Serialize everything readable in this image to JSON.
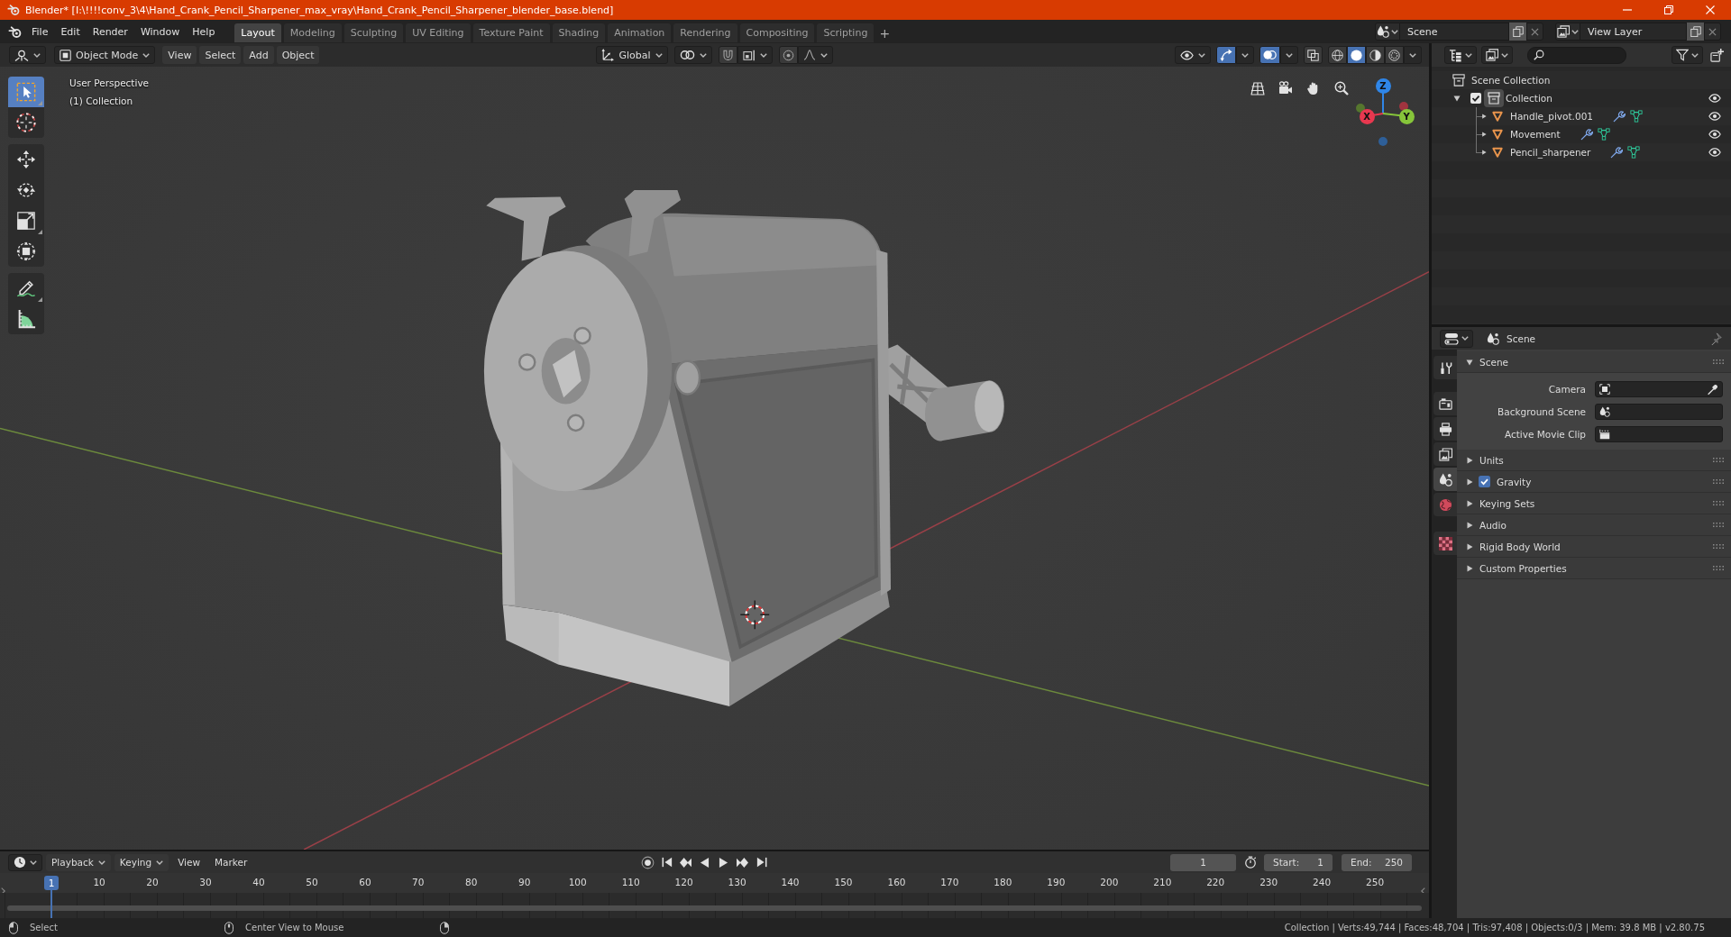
{
  "window": {
    "title": "Blender* [I:\\!!!!conv_3\\4\\Hand_Crank_Pencil_Sharpener_max_vray\\Hand_Crank_Pencil_Sharpener_blender_base.blend]"
  },
  "menu": [
    "File",
    "Edit",
    "Render",
    "Window",
    "Help"
  ],
  "workspaces": [
    {
      "label": "Layout",
      "selected": true
    },
    {
      "label": "Modeling",
      "selected": false
    },
    {
      "label": "Sculpting",
      "selected": false
    },
    {
      "label": "UV Editing",
      "selected": false
    },
    {
      "label": "Texture Paint",
      "selected": false
    },
    {
      "label": "Shading",
      "selected": false
    },
    {
      "label": "Animation",
      "selected": false
    },
    {
      "label": "Rendering",
      "selected": false
    },
    {
      "label": "Compositing",
      "selected": false
    },
    {
      "label": "Scripting",
      "selected": false
    }
  ],
  "add_workspace": "+",
  "scene": {
    "value": "Scene"
  },
  "view_layer": {
    "value": "View Layer"
  },
  "viewport": {
    "mode": "Object Mode",
    "menus": [
      "View",
      "Select",
      "Add",
      "Object"
    ],
    "orientation": "Global",
    "toggles": {
      "snap": false,
      "proportional_editing": false,
      "gizmos": true,
      "overlays": true,
      "xray": false
    },
    "shading": [
      {
        "kind": "wireframe",
        "selected": false
      },
      {
        "kind": "solid",
        "selected": true
      },
      {
        "kind": "material",
        "selected": false
      },
      {
        "kind": "rendered",
        "selected": false
      }
    ],
    "tools": [
      {
        "kind": "select-box",
        "selected": true
      },
      {
        "kind": "cursor",
        "selected": false
      },
      {
        "kind": "move",
        "selected": false
      },
      {
        "kind": "rotate",
        "selected": false
      },
      {
        "kind": "scale",
        "selected": false
      },
      {
        "kind": "transform",
        "selected": false
      },
      {
        "kind": "annotate",
        "selected": false
      },
      {
        "kind": "measure",
        "selected": false
      }
    ],
    "info": [
      "User Perspective",
      "(1) Collection"
    ],
    "gizmo_axes": [
      {
        "label": "Z",
        "color": "#2f86e8"
      },
      {
        "label": "X",
        "color": "#e8384f"
      },
      {
        "label": "Y",
        "color": "#86c53a"
      }
    ]
  },
  "outliner": {
    "root": "Scene Collection",
    "items": [
      {
        "label": "Collection",
        "expanded": true,
        "checked": true,
        "visible": true,
        "children": [
          {
            "label": "Handle_pivot.001",
            "expanded": false,
            "visible": true
          },
          {
            "label": "Movement",
            "expanded": false,
            "visible": true
          },
          {
            "label": "Pencil_sharpener",
            "expanded": false,
            "visible": true
          }
        ]
      }
    ]
  },
  "properties": {
    "context": "Scene",
    "tabs": [
      {
        "kind": "tool",
        "selected": false
      },
      {
        "kind": "render",
        "selected": false
      },
      {
        "kind": "output",
        "selected": false
      },
      {
        "kind": "view-layer",
        "selected": false
      },
      {
        "kind": "scene",
        "selected": true
      },
      {
        "kind": "world",
        "selected": false
      },
      {
        "kind": "texture",
        "selected": false
      }
    ],
    "panels": [
      {
        "label": "Scene",
        "expanded": true,
        "fields": [
          {
            "label": "Camera",
            "kind": "camera"
          },
          {
            "label": "Background Scene",
            "kind": "scene"
          },
          {
            "label": "Active Movie Clip",
            "kind": "movie-clip"
          }
        ]
      },
      {
        "label": "Units",
        "expanded": false
      },
      {
        "label": "Gravity",
        "expanded": false,
        "checkbox": {
          "checked": true
        }
      },
      {
        "label": "Keying Sets",
        "expanded": false
      },
      {
        "label": "Audio",
        "expanded": false
      },
      {
        "label": "Rigid Body World",
        "expanded": false
      },
      {
        "label": "Custom Properties",
        "expanded": false
      }
    ]
  },
  "timeline": {
    "menus": [
      {
        "label": "Playback",
        "kind": "dropdown"
      },
      {
        "label": "Keying",
        "kind": "dropdown"
      },
      {
        "label": "View",
        "kind": "menu"
      },
      {
        "label": "Marker",
        "kind": "menu"
      }
    ],
    "current_frame": "1",
    "start": {
      "label": "Start:",
      "value": "1"
    },
    "end": {
      "label": "End:",
      "value": "250"
    },
    "playhead": "1",
    "ruler": [
      "10",
      "20",
      "30",
      "40",
      "50",
      "60",
      "70",
      "80",
      "90",
      "100",
      "110",
      "120",
      "130",
      "140",
      "150",
      "160",
      "170",
      "180",
      "190",
      "200",
      "210",
      "220",
      "230",
      "240",
      "250"
    ]
  },
  "status_bar": {
    "hints": [
      {
        "kind": "mouse-left",
        "label": "Select"
      },
      {
        "kind": "mouse-middle",
        "label": "Center View to Mouse"
      },
      {
        "kind": "mouse-right"
      }
    ],
    "stats": "Collection | Verts:49,744 | Faces:48,704 | Tris:97,408 | Objects:0/3 | Mem: 39.8 MB | v2.80.75"
  }
}
